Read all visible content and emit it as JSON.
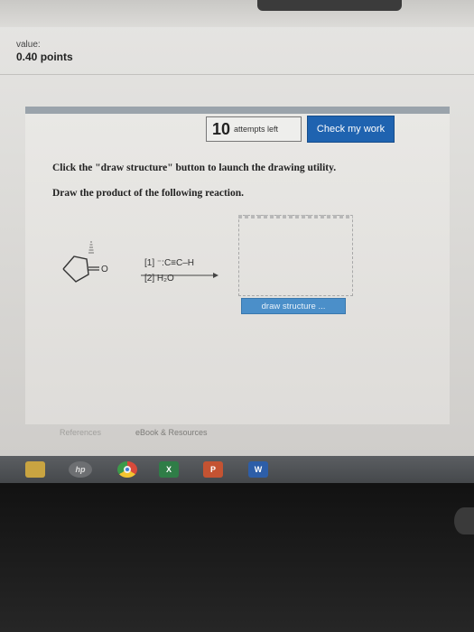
{
  "header": {
    "value_label": "value:",
    "value_points": "0.40 points"
  },
  "toolbar": {
    "attempts_count": "10",
    "attempts_label": "attempts left",
    "check_label": "Check my work"
  },
  "question": {
    "instruction_1": "Click the \"draw structure\" button to launch the drawing utility.",
    "instruction_2": "Draw the product of the following reaction.",
    "reactant_atom": "O",
    "reagent_1": "[1] ⁻:C≡C–H",
    "reagent_2": "[2] H₂O",
    "draw_button": "draw structure ..."
  },
  "footer": {
    "references": "References",
    "ebook": "eBook & Resources"
  },
  "taskbar": {
    "icons": [
      "folder-icon",
      "hp-icon",
      "chrome-icon",
      "excel-icon",
      "powerpoint-icon",
      "word-icon"
    ],
    "excel_letter": "X",
    "powerpoint_letter": "P",
    "word_letter": "W",
    "hp_letter": "hp"
  },
  "colors": {
    "check_button": "#1f63b0",
    "draw_button": "#4b8fc9",
    "panel_bar": "#9aa3ab"
  }
}
